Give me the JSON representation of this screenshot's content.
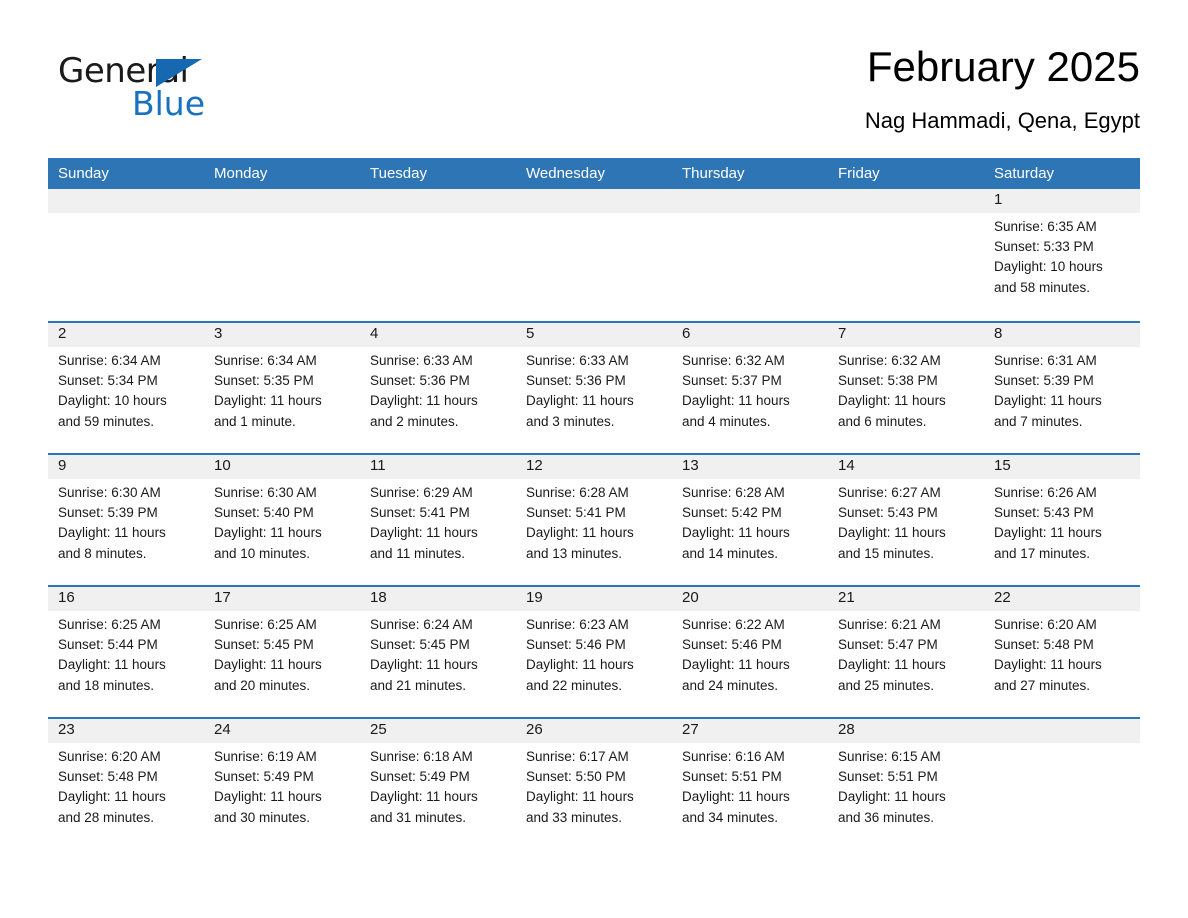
{
  "brand": {
    "name_part1": "General",
    "name_part2": "Blue",
    "triangle_color": "#1669b0",
    "blue_color": "#1872bd"
  },
  "header": {
    "month_title": "February 2025",
    "location": "Nag Hammadi, Qena, Egypt"
  },
  "theme": {
    "header_blue": "#2e75b6",
    "row_divider_blue": "#2e75b6",
    "daynum_strip_gray": "#f0f0f0"
  },
  "weekdays": [
    {
      "label": "Sunday"
    },
    {
      "label": "Monday"
    },
    {
      "label": "Tuesday"
    },
    {
      "label": "Wednesday"
    },
    {
      "label": "Thursday"
    },
    {
      "label": "Friday"
    },
    {
      "label": "Saturday"
    }
  ],
  "weeks": [
    {
      "days": [
        {
          "number": "",
          "sunrise": "",
          "sunset": "",
          "daylight": "",
          "empty": true
        },
        {
          "number": "",
          "sunrise": "",
          "sunset": "",
          "daylight": "",
          "empty": true
        },
        {
          "number": "",
          "sunrise": "",
          "sunset": "",
          "daylight": "",
          "empty": true
        },
        {
          "number": "",
          "sunrise": "",
          "sunset": "",
          "daylight": "",
          "empty": true
        },
        {
          "number": "",
          "sunrise": "",
          "sunset": "",
          "daylight": "",
          "empty": true
        },
        {
          "number": "",
          "sunrise": "",
          "sunset": "",
          "daylight": "",
          "empty": true
        },
        {
          "number": "1",
          "sunrise": "Sunrise: 6:35 AM",
          "sunset": "Sunset: 5:33 PM",
          "daylight": "Daylight: 10 hours and 58 minutes.",
          "empty": false
        }
      ]
    },
    {
      "days": [
        {
          "number": "2",
          "sunrise": "Sunrise: 6:34 AM",
          "sunset": "Sunset: 5:34 PM",
          "daylight": "Daylight: 10 hours and 59 minutes.",
          "empty": false
        },
        {
          "number": "3",
          "sunrise": "Sunrise: 6:34 AM",
          "sunset": "Sunset: 5:35 PM",
          "daylight": "Daylight: 11 hours and 1 minute.",
          "empty": false
        },
        {
          "number": "4",
          "sunrise": "Sunrise: 6:33 AM",
          "sunset": "Sunset: 5:36 PM",
          "daylight": "Daylight: 11 hours and 2 minutes.",
          "empty": false
        },
        {
          "number": "5",
          "sunrise": "Sunrise: 6:33 AM",
          "sunset": "Sunset: 5:36 PM",
          "daylight": "Daylight: 11 hours and 3 minutes.",
          "empty": false
        },
        {
          "number": "6",
          "sunrise": "Sunrise: 6:32 AM",
          "sunset": "Sunset: 5:37 PM",
          "daylight": "Daylight: 11 hours and 4 minutes.",
          "empty": false
        },
        {
          "number": "7",
          "sunrise": "Sunrise: 6:32 AM",
          "sunset": "Sunset: 5:38 PM",
          "daylight": "Daylight: 11 hours and 6 minutes.",
          "empty": false
        },
        {
          "number": "8",
          "sunrise": "Sunrise: 6:31 AM",
          "sunset": "Sunset: 5:39 PM",
          "daylight": "Daylight: 11 hours and 7 minutes.",
          "empty": false
        }
      ]
    },
    {
      "days": [
        {
          "number": "9",
          "sunrise": "Sunrise: 6:30 AM",
          "sunset": "Sunset: 5:39 PM",
          "daylight": "Daylight: 11 hours and 8 minutes.",
          "empty": false
        },
        {
          "number": "10",
          "sunrise": "Sunrise: 6:30 AM",
          "sunset": "Sunset: 5:40 PM",
          "daylight": "Daylight: 11 hours and 10 minutes.",
          "empty": false
        },
        {
          "number": "11",
          "sunrise": "Sunrise: 6:29 AM",
          "sunset": "Sunset: 5:41 PM",
          "daylight": "Daylight: 11 hours and 11 minutes.",
          "empty": false
        },
        {
          "number": "12",
          "sunrise": "Sunrise: 6:28 AM",
          "sunset": "Sunset: 5:41 PM",
          "daylight": "Daylight: 11 hours and 13 minutes.",
          "empty": false
        },
        {
          "number": "13",
          "sunrise": "Sunrise: 6:28 AM",
          "sunset": "Sunset: 5:42 PM",
          "daylight": "Daylight: 11 hours and 14 minutes.",
          "empty": false
        },
        {
          "number": "14",
          "sunrise": "Sunrise: 6:27 AM",
          "sunset": "Sunset: 5:43 PM",
          "daylight": "Daylight: 11 hours and 15 minutes.",
          "empty": false
        },
        {
          "number": "15",
          "sunrise": "Sunrise: 6:26 AM",
          "sunset": "Sunset: 5:43 PM",
          "daylight": "Daylight: 11 hours and 17 minutes.",
          "empty": false
        }
      ]
    },
    {
      "days": [
        {
          "number": "16",
          "sunrise": "Sunrise: 6:25 AM",
          "sunset": "Sunset: 5:44 PM",
          "daylight": "Daylight: 11 hours and 18 minutes.",
          "empty": false
        },
        {
          "number": "17",
          "sunrise": "Sunrise: 6:25 AM",
          "sunset": "Sunset: 5:45 PM",
          "daylight": "Daylight: 11 hours and 20 minutes.",
          "empty": false
        },
        {
          "number": "18",
          "sunrise": "Sunrise: 6:24 AM",
          "sunset": "Sunset: 5:45 PM",
          "daylight": "Daylight: 11 hours and 21 minutes.",
          "empty": false
        },
        {
          "number": "19",
          "sunrise": "Sunrise: 6:23 AM",
          "sunset": "Sunset: 5:46 PM",
          "daylight": "Daylight: 11 hours and 22 minutes.",
          "empty": false
        },
        {
          "number": "20",
          "sunrise": "Sunrise: 6:22 AM",
          "sunset": "Sunset: 5:46 PM",
          "daylight": "Daylight: 11 hours and 24 minutes.",
          "empty": false
        },
        {
          "number": "21",
          "sunrise": "Sunrise: 6:21 AM",
          "sunset": "Sunset: 5:47 PM",
          "daylight": "Daylight: 11 hours and 25 minutes.",
          "empty": false
        },
        {
          "number": "22",
          "sunrise": "Sunrise: 6:20 AM",
          "sunset": "Sunset: 5:48 PM",
          "daylight": "Daylight: 11 hours and 27 minutes.",
          "empty": false
        }
      ]
    },
    {
      "days": [
        {
          "number": "23",
          "sunrise": "Sunrise: 6:20 AM",
          "sunset": "Sunset: 5:48 PM",
          "daylight": "Daylight: 11 hours and 28 minutes.",
          "empty": false
        },
        {
          "number": "24",
          "sunrise": "Sunrise: 6:19 AM",
          "sunset": "Sunset: 5:49 PM",
          "daylight": "Daylight: 11 hours and 30 minutes.",
          "empty": false
        },
        {
          "number": "25",
          "sunrise": "Sunrise: 6:18 AM",
          "sunset": "Sunset: 5:49 PM",
          "daylight": "Daylight: 11 hours and 31 minutes.",
          "empty": false
        },
        {
          "number": "26",
          "sunrise": "Sunrise: 6:17 AM",
          "sunset": "Sunset: 5:50 PM",
          "daylight": "Daylight: 11 hours and 33 minutes.",
          "empty": false
        },
        {
          "number": "27",
          "sunrise": "Sunrise: 6:16 AM",
          "sunset": "Sunset: 5:51 PM",
          "daylight": "Daylight: 11 hours and 34 minutes.",
          "empty": false
        },
        {
          "number": "28",
          "sunrise": "Sunrise: 6:15 AM",
          "sunset": "Sunset: 5:51 PM",
          "daylight": "Daylight: 11 hours and 36 minutes.",
          "empty": false
        },
        {
          "number": "",
          "sunrise": "",
          "sunset": "",
          "daylight": "",
          "empty": true
        }
      ]
    }
  ]
}
